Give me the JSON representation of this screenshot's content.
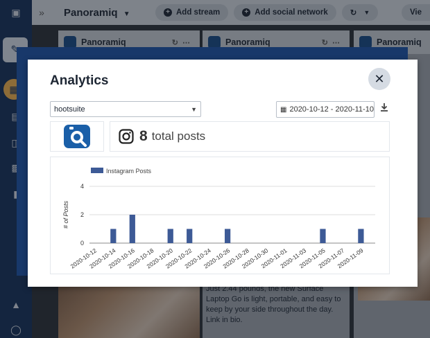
{
  "topbar": {
    "collapse_icon": "double-chevron-icon",
    "dashboard_title": "Panoramiq",
    "add_stream_label": "Add stream",
    "add_network_label": "Add social network",
    "view_label": "Vie"
  },
  "streams": [
    {
      "title": "Panoramiq"
    },
    {
      "title": "Panoramiq"
    },
    {
      "title": "Panoramiq"
    }
  ],
  "background_caption": "Just 2.44 pounds, the new Surface Laptop Go is light, portable, and easy to keep by your side throughout the day. Link in bio.",
  "modal": {
    "title": "Analytics",
    "account_select": {
      "value": "hootsuite"
    },
    "date_range": "2020-10-12 - 2020-11-10",
    "total_count": "8",
    "total_label": "total posts"
  },
  "colors": {
    "bar": "#3d5a96",
    "brand_blue": "#1a5fa8"
  },
  "chart_data": {
    "type": "bar",
    "legend": {
      "label": "Instagram Posts",
      "position": "top-left"
    },
    "ylabel": "# of Posts",
    "ylim": [
      0,
      4
    ],
    "yticks": [
      0,
      2,
      4
    ],
    "x_tick_labels": [
      "2020-10-12",
      "2020-10-14",
      "2020-10-16",
      "2020-10-18",
      "2020-10-20",
      "2020-10-22",
      "2020-10-24",
      "2020-10-26",
      "2020-10-28",
      "2020-10-30",
      "2020-11-01",
      "2020-11-03",
      "2020-11-05",
      "2020-11-07",
      "2020-11-09"
    ],
    "x_start": "2020-10-12",
    "x_end": "2020-11-10",
    "series": [
      {
        "name": "Instagram Posts",
        "points": [
          {
            "x": "2020-10-14",
            "y": 1
          },
          {
            "x": "2020-10-16",
            "y": 2
          },
          {
            "x": "2020-10-20",
            "y": 1
          },
          {
            "x": "2020-10-22",
            "y": 1
          },
          {
            "x": "2020-10-26",
            "y": 1
          },
          {
            "x": "2020-11-05",
            "y": 1
          },
          {
            "x": "2020-11-09",
            "y": 1
          }
        ]
      }
    ]
  }
}
